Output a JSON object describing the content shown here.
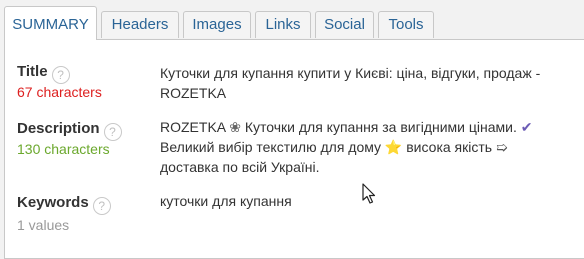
{
  "tabs": [
    {
      "label": "SUMMARY",
      "active": true
    },
    {
      "label": "Headers",
      "active": false
    },
    {
      "label": "Images",
      "active": false
    },
    {
      "label": "Links",
      "active": false
    },
    {
      "label": "Social",
      "active": false
    },
    {
      "label": "Tools",
      "active": false
    }
  ],
  "summary": {
    "title": {
      "label": "Title",
      "meta": "67 characters",
      "meta_color": "#dd1f1f",
      "value_line1": "Куточки для купання купити у Києві: ціна, відгуки, продаж -",
      "value_line2": "ROZETKA"
    },
    "description": {
      "label": "Description",
      "meta": "130 characters",
      "meta_color": "#6ba82d",
      "part1": "ROZETKA ",
      "glyph1": "❀",
      "part2": " Куточки для купання за вигідними цінами. ",
      "glyph2": "✔",
      "part3": "Великий вибір текстилю для дому ",
      "glyph3": "⭐",
      "part4": " висока якість ",
      "glyph4": "➯",
      "part5": "доставка по всій Україні."
    },
    "keywords": {
      "label": "Keywords",
      "meta": "1 values",
      "value": "куточки для купання"
    }
  },
  "help_icon_glyph": "?",
  "colors": {
    "tab_text": "#2a6496",
    "panel_bg": "#ffffff",
    "page_bg": "#f2f2f2",
    "check_color": "#6b5bb5",
    "star_color": "#f5b800"
  }
}
